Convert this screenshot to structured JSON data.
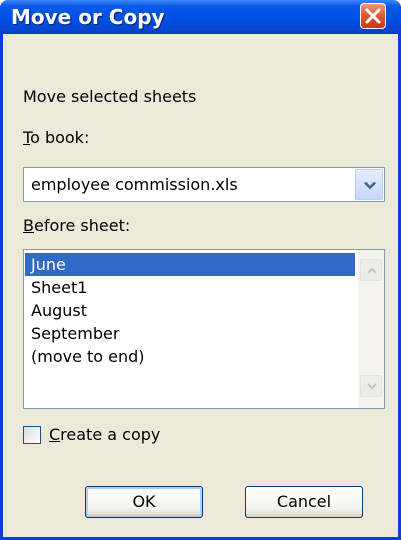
{
  "dialog": {
    "title": "Move or Copy",
    "close_icon": "close-icon"
  },
  "move_label": "Move selected sheets",
  "to_book": {
    "label_mnemonic": "T",
    "label_rest": "o book:",
    "value": "employee commission.xls",
    "dropdown_icon": "chevron-down-icon"
  },
  "before_sheet": {
    "label_mnemonic": "B",
    "label_rest": "efore sheet:",
    "items": [
      "June",
      "Sheet1",
      "August",
      "September",
      "(move to end)"
    ],
    "selected_index": 0
  },
  "create_copy": {
    "label_mnemonic": "C",
    "label_rest": "reate a copy",
    "checked": false
  },
  "buttons": {
    "ok": "OK",
    "cancel": "Cancel"
  },
  "colors": {
    "title_bar": "#0050e2",
    "dialog_background": "#ece9d8",
    "selection": "#316ac5",
    "close_button": "#e05a34"
  }
}
